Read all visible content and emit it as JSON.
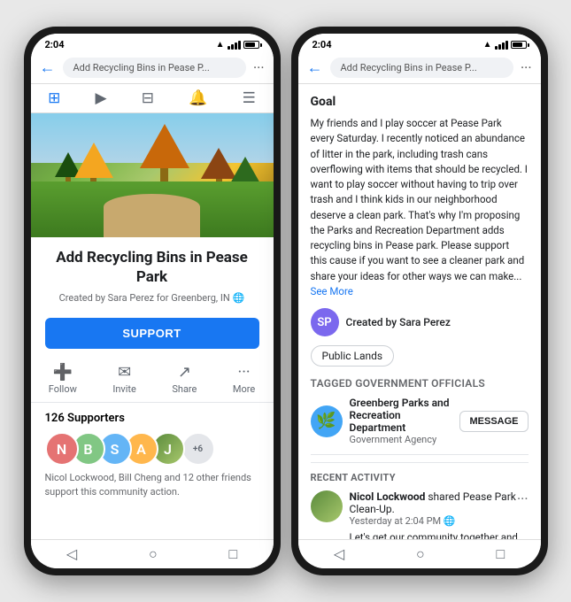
{
  "app": {
    "title": "Add Recycling Bins in Pease P...",
    "time": "2:04"
  },
  "phone1": {
    "nav": {
      "search_text": "Add Recycling Bins in Pease P...",
      "back_label": "←",
      "more_label": "···"
    },
    "petition": {
      "title": "Add Recycling Bins in Pease Park",
      "created_by": "Created by Sara Perez for Greenberg, IN",
      "support_label": "SUPPORT"
    },
    "actions": [
      {
        "icon": "➕",
        "label": "Follow"
      },
      {
        "icon": "✉",
        "label": "Invite"
      },
      {
        "icon": "↗",
        "label": "Share"
      },
      {
        "icon": "···",
        "label": "More"
      }
    ],
    "supporters": {
      "count": "126 Supporters",
      "extra": "+6",
      "description": "Nicol Lockwood, Bill Cheng and 12 other friends support this community action."
    },
    "bottom_nav": [
      "🏠",
      "▶",
      "🏪",
      "🔔",
      "☰"
    ]
  },
  "phone2": {
    "nav": {
      "search_text": "Add Recycling Bins in Pease P...",
      "back_label": "←",
      "more_label": "···"
    },
    "goal": {
      "heading": "Goal",
      "text": "My friends and I play soccer at Pease Park every Saturday. I recently noticed an abundance of litter in the park, including trash cans overflowing with items that should be recycled. I want to play soccer without having to trip over trash and I think kids in our neighborhood deserve a clean park. That's why I'm proposing the Parks and Recreation Department adds recycling bins in Pease park. Please support this cause if you want to see a cleaner park and share your ideas for other ways we can make...",
      "see_more": "See More"
    },
    "creator": {
      "name": "Created by Sara Perez",
      "initials": "SP"
    },
    "tag": "Public Lands",
    "tagged_officials": {
      "heading": "Tagged Government Officials",
      "agency": {
        "name": "Greenberg Parks and Recreation  Department",
        "type": "Government Agency",
        "message_label": "MESSAGE"
      }
    },
    "recent_activity": {
      "heading": "RECENT ACTIVITY",
      "item": {
        "name": "Nicol Lockwood",
        "action": "shared Pease Park Clean-Up.",
        "time": "Yesterday at 2:04 PM",
        "visibility": "🌐",
        "text": "Let's get our community together and volunteer to clean up Pease Park before our next soccer game."
      }
    },
    "bottom_nav": [
      "◁",
      "○",
      "□"
    ]
  },
  "colors": {
    "facebook_blue": "#1877f2",
    "text_primary": "#1c1e21",
    "text_secondary": "#65676b",
    "bg_light": "#f0f2f5",
    "border": "#e4e6ea"
  }
}
